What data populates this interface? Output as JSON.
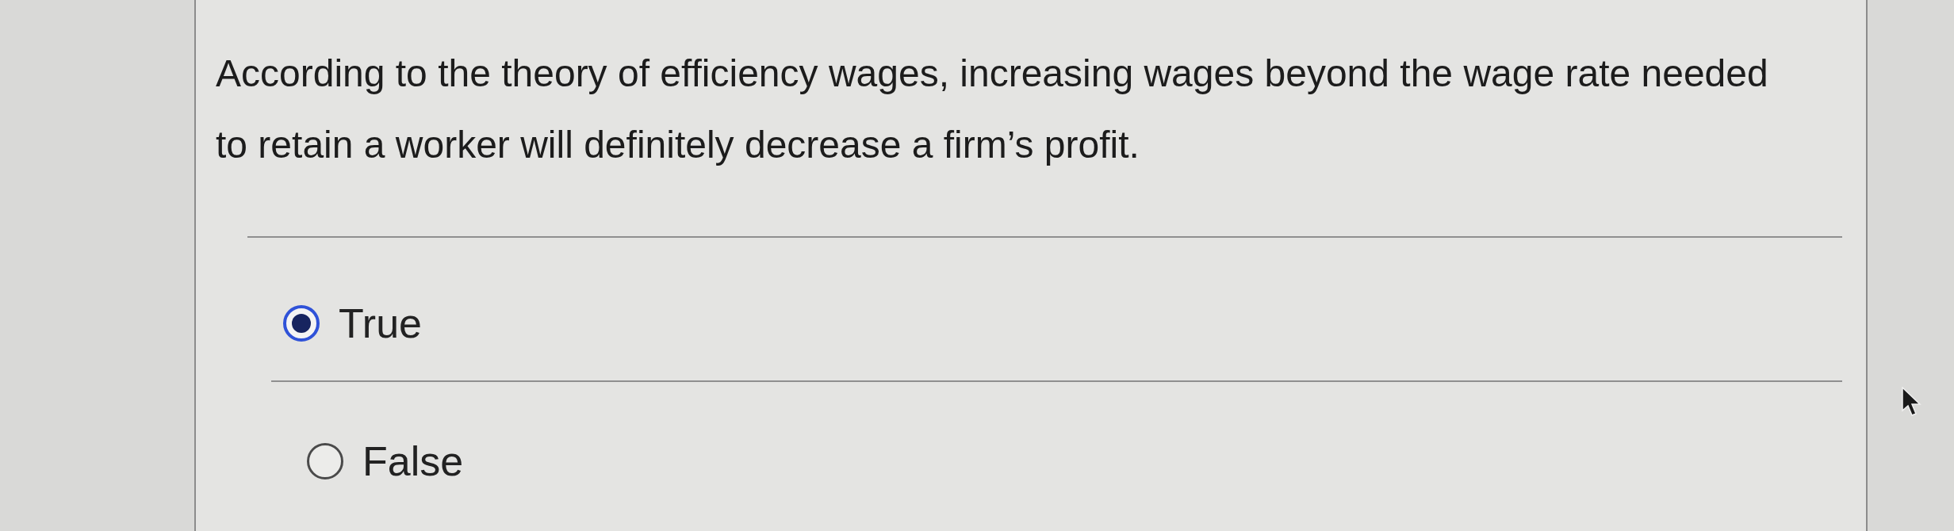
{
  "question": {
    "text": "According to the theory of efficiency wages, increasing wages beyond the wage rate needed to retain a worker will definitely decrease a firm’s profit."
  },
  "options": [
    {
      "label": "True",
      "selected": true
    },
    {
      "label": "False",
      "selected": false
    }
  ]
}
